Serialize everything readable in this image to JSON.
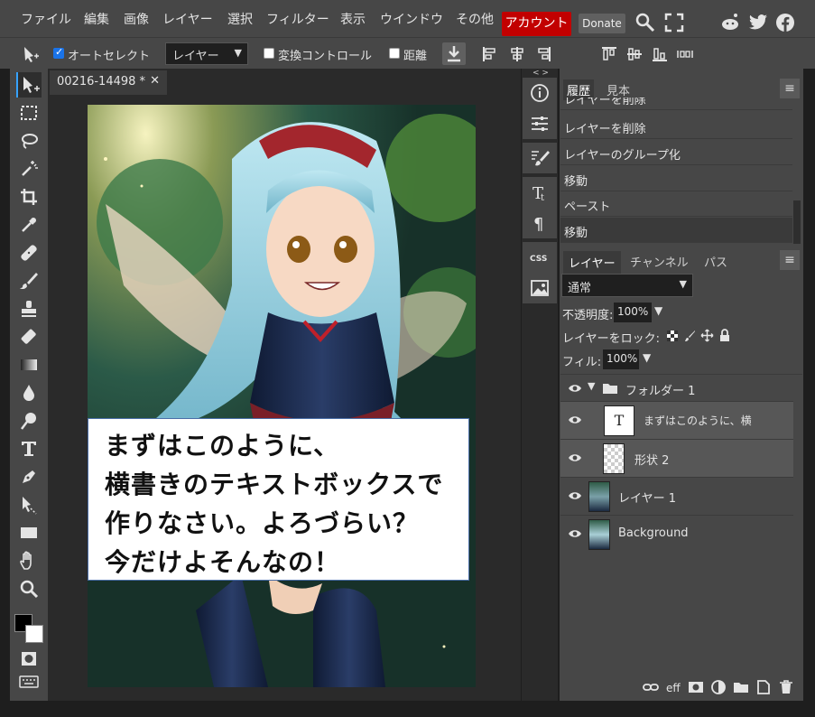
{
  "menu": {
    "items": [
      "ファイル",
      "編集",
      "画像",
      "レイヤー",
      "選択",
      "フィルター",
      "表示",
      "ウインドウ",
      "その他"
    ],
    "account_label": "アカウント",
    "donate_label": "Donate",
    "account_color": "#c20000"
  },
  "options": {
    "auto_select_label": "オートセレクト",
    "auto_select_checked": true,
    "target_value": "レイヤー",
    "transform_label": "変換コントロール",
    "distance_label": "距離"
  },
  "document": {
    "tab_title": "00216-14498",
    "tab_modified": "*",
    "text_lines": [
      "まずはこのように、",
      "横書きのテキストボックスで",
      "作りなさい。よろづらい？",
      "今だけよそんなの！"
    ]
  },
  "history": {
    "tabs": [
      "履歴",
      "見本"
    ],
    "items": [
      "レイヤーを削除",
      "レイヤーを削除",
      "レイヤーのグループ化",
      "移動",
      "ペースト",
      "移動"
    ],
    "active_index": 5
  },
  "layers": {
    "tabs": [
      "レイヤー",
      "チャンネル",
      "パス"
    ],
    "blend_mode": "通常",
    "opacity_label": "不透明度:",
    "opacity_value": "100%",
    "lock_label": "レイヤーをロック:",
    "fill_label": "フィル:",
    "fill_value": "100%",
    "items": [
      {
        "name": "フォルダー 1",
        "type": "folder"
      },
      {
        "name": "まずはこのように、横",
        "type": "text"
      },
      {
        "name": "形状 2",
        "type": "shape"
      },
      {
        "name": "レイヤー 1",
        "type": "image"
      },
      {
        "name": "Background",
        "type": "image"
      }
    ]
  }
}
